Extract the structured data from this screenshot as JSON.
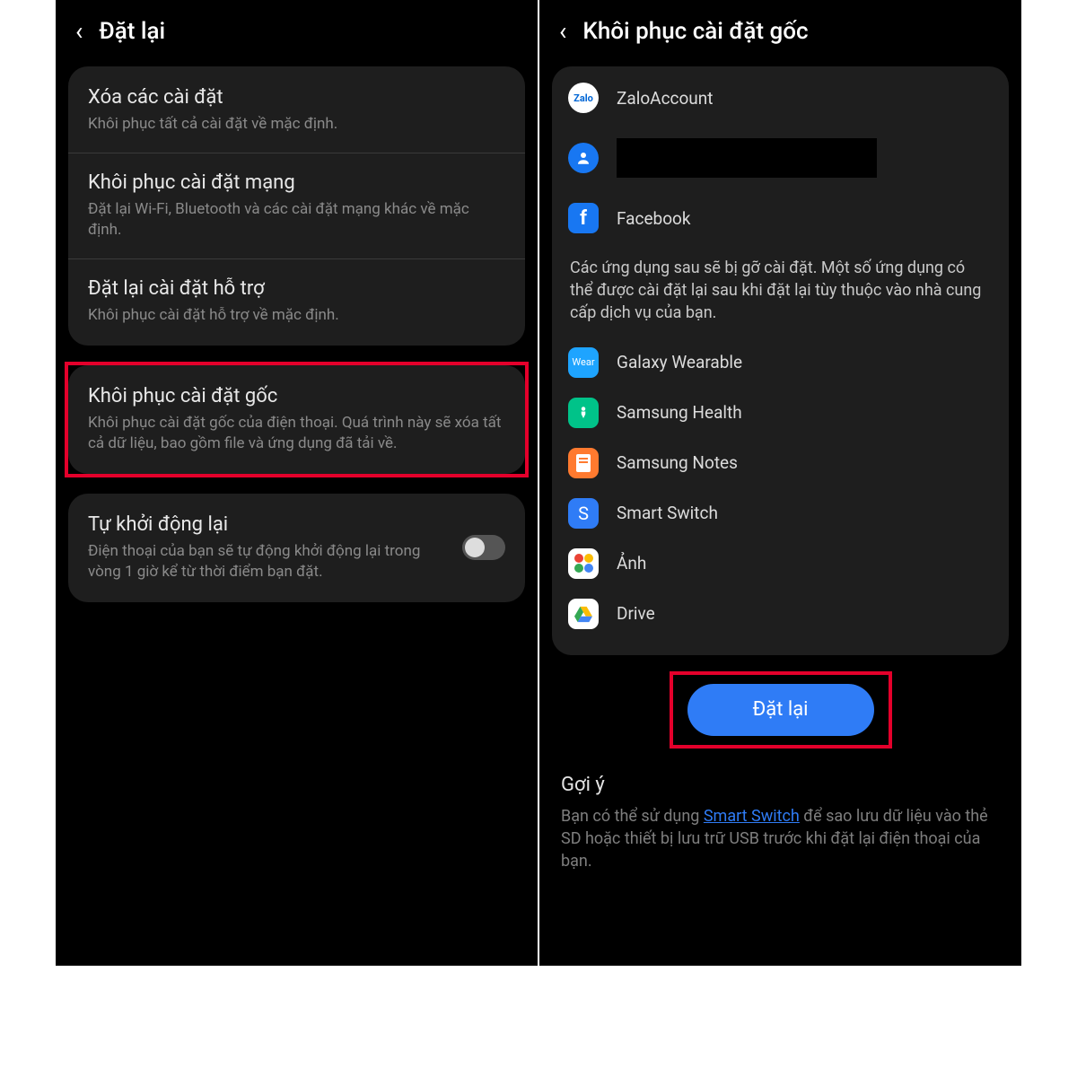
{
  "left": {
    "title": "Đặt lại",
    "card1": [
      {
        "title": "Xóa các cài đặt",
        "desc": "Khôi phục tất cả cài đặt về mặc định."
      },
      {
        "title": "Khôi phục cài đặt mạng",
        "desc": "Đặt lại Wi-Fi, Bluetooth và các cài đặt mạng khác về mặc định."
      },
      {
        "title": "Đặt lại cài đặt hỗ trợ",
        "desc": "Khôi phục cài đặt hỗ trợ về mặc định."
      }
    ],
    "factory": {
      "title": "Khôi phục cài đặt gốc",
      "desc": "Khôi phục cài đặt gốc của điện thoại. Quá trình này sẽ xóa tất cả dữ liệu, bao gồm file và ứng dụng đã tải về."
    },
    "autorestart": {
      "title": "Tự khởi động lại",
      "desc": "Điện thoại của bạn sẽ tự động khởi động lại trong vòng 1 giờ kể từ thời điểm bạn đặt."
    }
  },
  "right": {
    "title": "Khôi phục cài đặt gốc",
    "accounts": [
      {
        "label": "ZaloAccount",
        "icon": "zalo"
      },
      {
        "label": "",
        "icon": "person",
        "redacted": true
      },
      {
        "label": "Facebook",
        "icon": "fb"
      }
    ],
    "info": "Các ứng dụng sau sẽ bị gỡ cài đặt. Một số ứng dụng có thể được cài đặt lại sau khi đặt lại tùy thuộc vào nhà cung cấp dịch vụ của bạn.",
    "apps": [
      {
        "label": "Galaxy Wearable",
        "icon": "wear"
      },
      {
        "label": "Samsung Health",
        "icon": "health"
      },
      {
        "label": "Samsung Notes",
        "icon": "notes"
      },
      {
        "label": "Smart Switch",
        "icon": "switch"
      },
      {
        "label": "Ảnh",
        "icon": "photos"
      },
      {
        "label": "Drive",
        "icon": "drive"
      }
    ],
    "button": "Đặt lại",
    "hint_head": "Gợi ý",
    "hint_pre": "Bạn có thể sử dụng ",
    "hint_link": "Smart Switch",
    "hint_post": " để sao lưu dữ liệu vào thẻ SD hoặc thiết bị lưu trữ USB trước khi đặt lại điện thoại của bạn."
  }
}
